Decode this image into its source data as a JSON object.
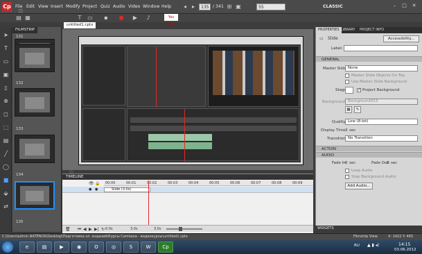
{
  "app": {
    "logo": "Cp"
  },
  "menubar": {
    "items": [
      "File",
      "Edit",
      "View",
      "Insert",
      "Modify",
      "Project",
      "Quiz",
      "Audio",
      "Video",
      "Window",
      "Help"
    ],
    "page_current": "135",
    "page_total": "/ 341",
    "zoom": "55",
    "workspace": "CLASSIC",
    "youtube_label": "You Tube"
  },
  "filmstrip": {
    "tab_label": "FILMSTRIP",
    "slides": [
      {
        "num": "131"
      },
      {
        "num": "132"
      },
      {
        "num": "133"
      },
      {
        "num": "134"
      },
      {
        "num": "135"
      }
    ]
  },
  "stage": {
    "doc_tab": "untitled1.cptx"
  },
  "timeline": {
    "tab_label": "TIMELINE",
    "slide_bar_label": "Slide (3.0s)",
    "ticks": [
      "00:00",
      "00:01",
      "00:02",
      "00:03",
      "00:04",
      "00:05",
      "00:06",
      "00:07",
      "00:08",
      "00:09"
    ],
    "time_a": "0.0s",
    "time_b": "3.0s",
    "time_c": "3.0s"
  },
  "properties": {
    "tabs": [
      "PROPERTIES",
      "LIBRARY",
      "PROJECT INFO"
    ],
    "slide_title": "Slide",
    "accessibility_btn": "Accessibility...",
    "label_label": "Label:",
    "general_section": "GENERAL",
    "master_slide_label": "Master Slide:",
    "master_slide_value": "None",
    "cb_master_objects": "Master Slide Objects On Top",
    "cb_use_master_bg": "Use Master Slide Background",
    "stage_label": "Stage:",
    "cb_project_bg": "Project Background",
    "background_label": "Background:",
    "background_value": "Background313",
    "quality_label": "Quality:",
    "quality_value": "Low (8-bit)",
    "display_time_label": "Display Time:",
    "display_time_value": "3",
    "display_time_unit": "sec",
    "transition_label": "Transition:",
    "transition_value": "No Transition",
    "action_section": "ACTION",
    "audio_section": "AUDIO",
    "fade_in_label": "Fade In:",
    "fade_in_value": "0",
    "fade_in_unit": "sec",
    "fade_out_label": "Fade Out:",
    "fade_out_value": "0",
    "fade_out_unit": "sec",
    "cb_loop_audio": "Loop Audio",
    "cb_stop_bg_audio": "Stop Background Audio",
    "add_audio_btn": "Add Audio...",
    "widgets_tab": "WIDGETS"
  },
  "status": {
    "path": "C:\\Users\\admin.NATENOK\\Desktop\\Подготовка эл. изданий\\Курсы Camtasia - видеокурсы\\untitled1.cptx",
    "view": "Filmstrip View",
    "coords": "X: 1422 Y: 465"
  },
  "taskbar": {
    "lang": "RU",
    "time": "14:15",
    "date": "03.06.2012"
  }
}
